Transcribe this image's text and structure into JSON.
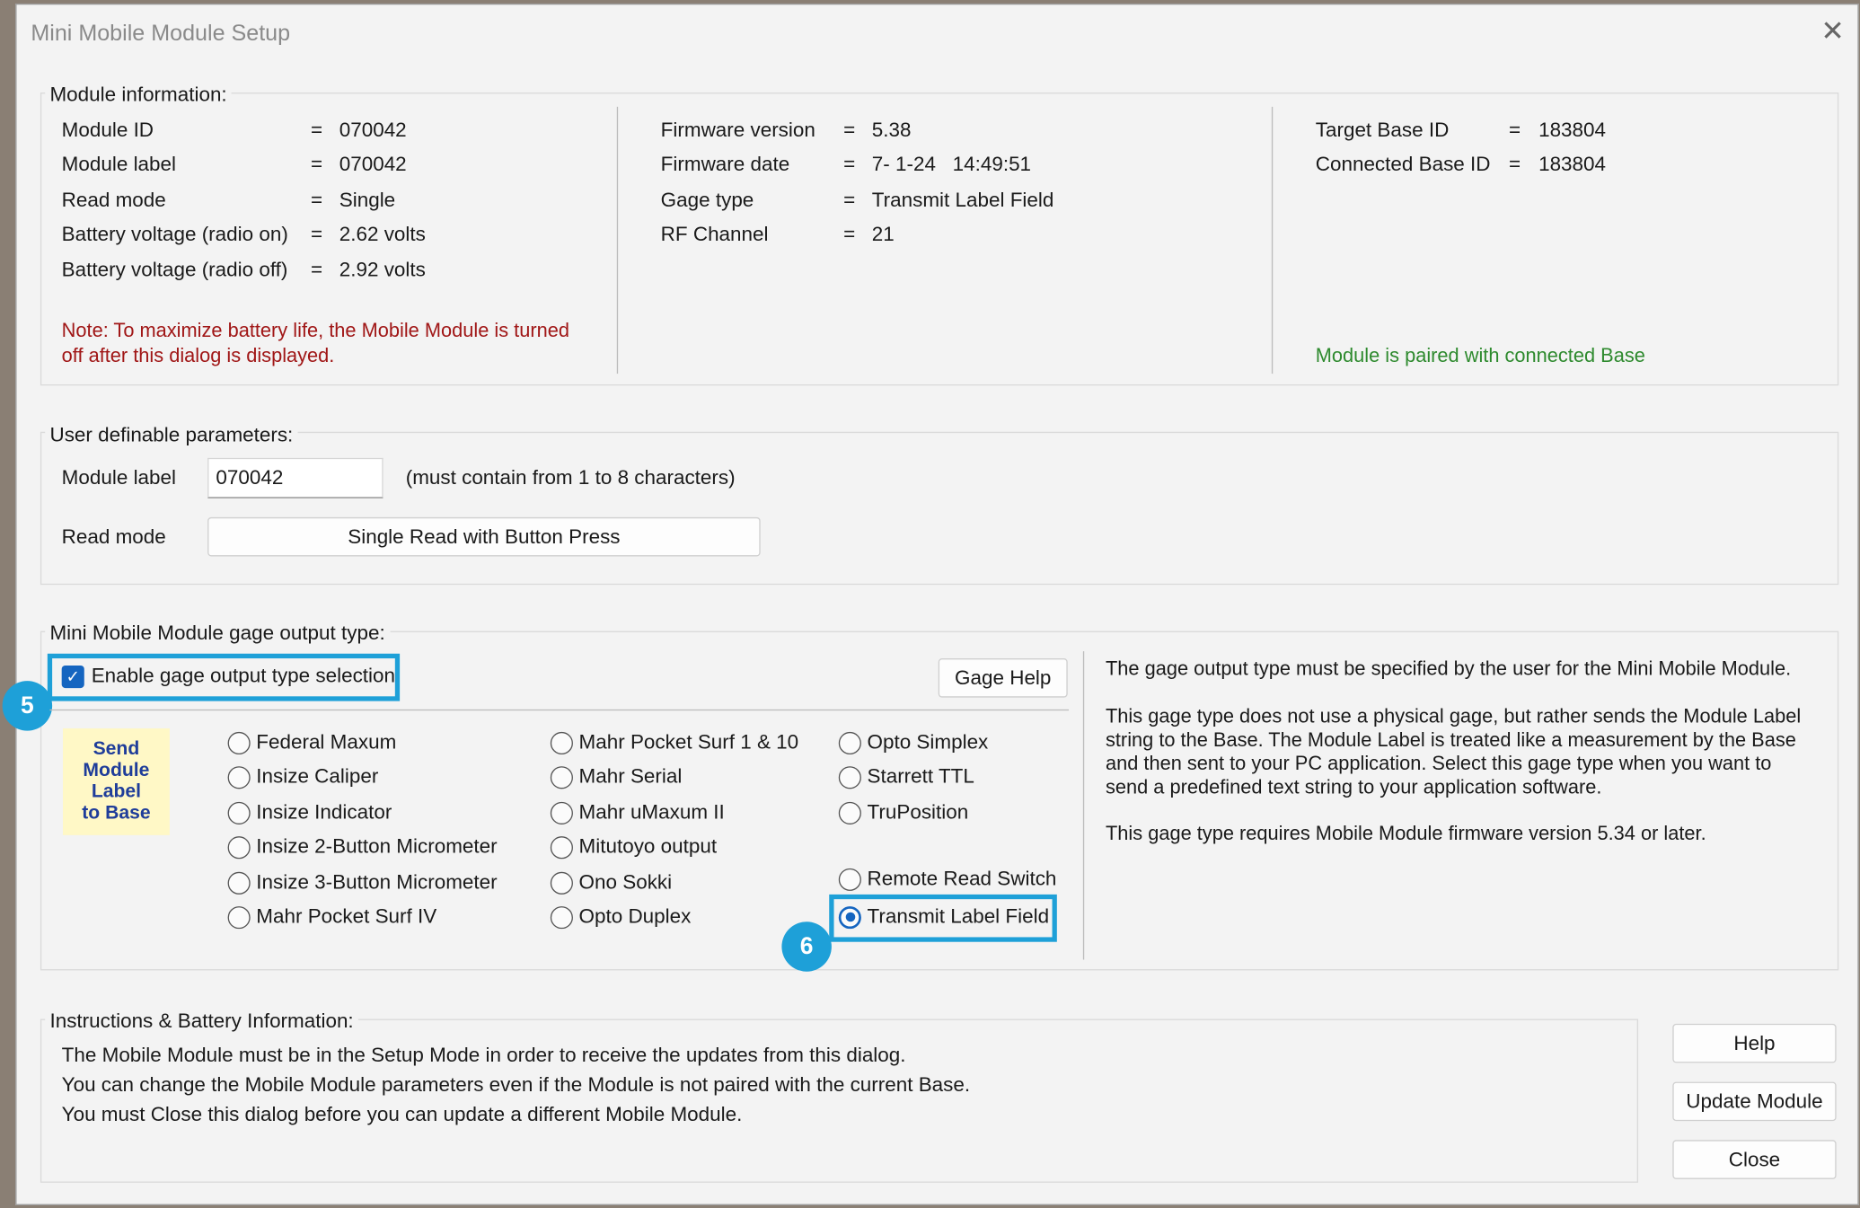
{
  "window": {
    "title": "Mini Mobile Module Setup"
  },
  "module_info": {
    "legend": "Module information:",
    "left": [
      {
        "label": "Module ID",
        "value": "070042"
      },
      {
        "label": "Module label",
        "value": "070042"
      },
      {
        "label": "Read mode",
        "value": "Single"
      },
      {
        "label": "Battery voltage (radio on)",
        "value": "2.62 volts"
      },
      {
        "label": "Battery voltage (radio off)",
        "value": "2.92 volts"
      }
    ],
    "middle": [
      {
        "label": "Firmware version",
        "value": "5.38"
      },
      {
        "label": "Firmware date",
        "value": "7- 1-24   14:49:51"
      },
      {
        "label": "Gage type",
        "value": "Transmit Label Field"
      },
      {
        "label": "RF Channel",
        "value": "21"
      }
    ],
    "right": [
      {
        "label": "Target Base ID",
        "value": "183804"
      },
      {
        "label": "Connected Base ID",
        "value": "183804"
      }
    ],
    "equals": "=",
    "note_line1": "Note: To maximize battery life, the Mobile Module is turned",
    "note_line2": "off after this dialog is displayed.",
    "paired_status": "Module is paired with connected Base"
  },
  "user_params": {
    "legend": "User definable parameters:",
    "module_label_label": "Module label",
    "module_label_value": "070042",
    "module_label_hint": "(must contain from 1 to 8 characters)",
    "read_mode_label": "Read mode",
    "read_mode_value": "Single Read with Button Press"
  },
  "gage_output": {
    "legend": "Mini Mobile Module gage output type:",
    "enable_label": "Enable gage output type selection",
    "enable_checked": true,
    "gage_help_label": "Gage Help",
    "send_label_lines": [
      "Send",
      "Module",
      "Label",
      "to Base"
    ],
    "col1": [
      "Federal Maxum",
      "Insize Caliper",
      "Insize Indicator",
      "Insize 2-Button Micrometer",
      "Insize 3-Button Micrometer",
      "Mahr Pocket Surf IV"
    ],
    "col2": [
      "Mahr Pocket Surf 1 & 10",
      "Mahr Serial",
      "Mahr uMaxum II",
      "Mitutoyo output",
      "Ono Sokki",
      "Opto Duplex"
    ],
    "col3_top": [
      "Opto Simplex",
      "Starrett TTL",
      "TruPosition"
    ],
    "col3_bottom": [
      "Remote Read Switch",
      "Transmit Label Field"
    ],
    "selected": "Transmit Label Field",
    "description": {
      "p1": "The gage output type must be specified by the user for the Mini Mobile Module.",
      "p2_lines": [
        "This gage type does not use a physical gage, but rather sends the Module Label",
        "string to the Base.  The Module Label is treated like a measurement by the Base",
        "and then sent to your PC application.  Select this gage type when you want to",
        "send a predefined text string to your application software."
      ],
      "p3": "This gage type requires Mobile Module firmware version 5.34 or later."
    }
  },
  "instructions": {
    "legend": "Instructions & Battery Information:",
    "lines": [
      "The Mobile Module must be in the Setup Mode in order to receive the updates from this dialog.",
      "You can change the Mobile Module parameters even if the Module is not paired with the current Base.",
      "You must Close this dialog before you can update a different Mobile Module."
    ]
  },
  "buttons": {
    "help": "Help",
    "update": "Update Module",
    "close": "Close"
  },
  "callouts": {
    "step5": "5",
    "step6": "6"
  },
  "colors": {
    "accent": "#1565c0",
    "highlight": "#1ea0d8",
    "note": "#a01616",
    "status_ok": "#2e8a2e"
  }
}
